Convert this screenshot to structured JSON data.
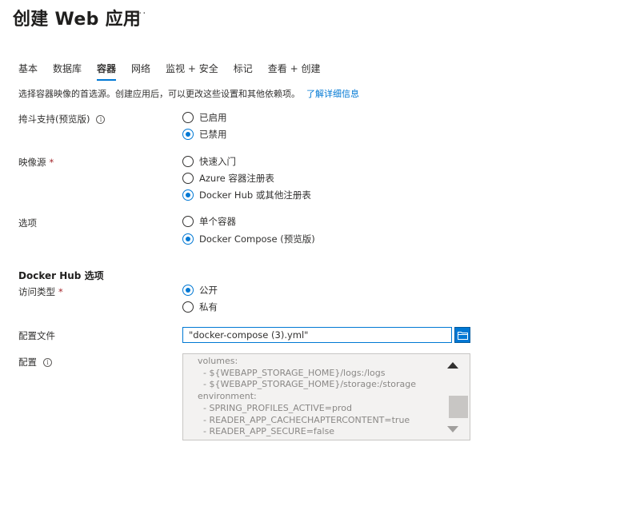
{
  "header": {
    "title": "创建 Web 应用",
    "more": "···"
  },
  "tabs": [
    {
      "label": "基本"
    },
    {
      "label": "数据库"
    },
    {
      "label": "容器",
      "active": true
    },
    {
      "label": "网络"
    },
    {
      "label": "监视 + 安全"
    },
    {
      "label": "标记"
    },
    {
      "label": "查看 + 创建"
    }
  ],
  "description": {
    "text": "选择容器映像的首选源。创建应用后，可以更改这些设置和其他依赖项。",
    "link": "了解详细信息"
  },
  "sidecar": {
    "label": "挎斗支持(预览版)",
    "options": [
      "已启用",
      "已禁用"
    ],
    "selected": "已禁用"
  },
  "image_source": {
    "label": "映像源",
    "required_mark": "*",
    "options": [
      "快速入门",
      "Azure 容器注册表",
      "Docker Hub 或其他注册表"
    ],
    "selected": "Docker Hub 或其他注册表"
  },
  "options": {
    "label": "选项",
    "options": [
      "单个容器",
      "Docker Compose (预览版)"
    ],
    "selected": "Docker Compose (预览版)"
  },
  "docker_hub": {
    "section_title": "Docker Hub 选项",
    "access_type": {
      "label": "访问类型",
      "required_mark": "*",
      "options": [
        "公开",
        "私有"
      ],
      "selected": "公开"
    },
    "config_file": {
      "label": "配置文件",
      "value": "\"docker-compose (3).yml\""
    },
    "config": {
      "label": "配置",
      "lines": [
        "volumes:",
        "  - ${WEBAPP_STORAGE_HOME}/logs:/logs",
        "  - ${WEBAPP_STORAGE_HOME}/storage:/storage",
        "environment:",
        "  - SPRING_PROFILES_ACTIVE=prod",
        "  - READER_APP_CACHECHAPTERCONTENT=true",
        "  - READER_APP_SECURE=false"
      ]
    }
  },
  "icons": {
    "info": "info-circle-icon",
    "browse": "folder-browse-icon",
    "more": "ellipsis-icon"
  },
  "colors": {
    "accent": "#0078d4",
    "required": "#a4262c",
    "disabled_bg": "#f3f2f1"
  }
}
